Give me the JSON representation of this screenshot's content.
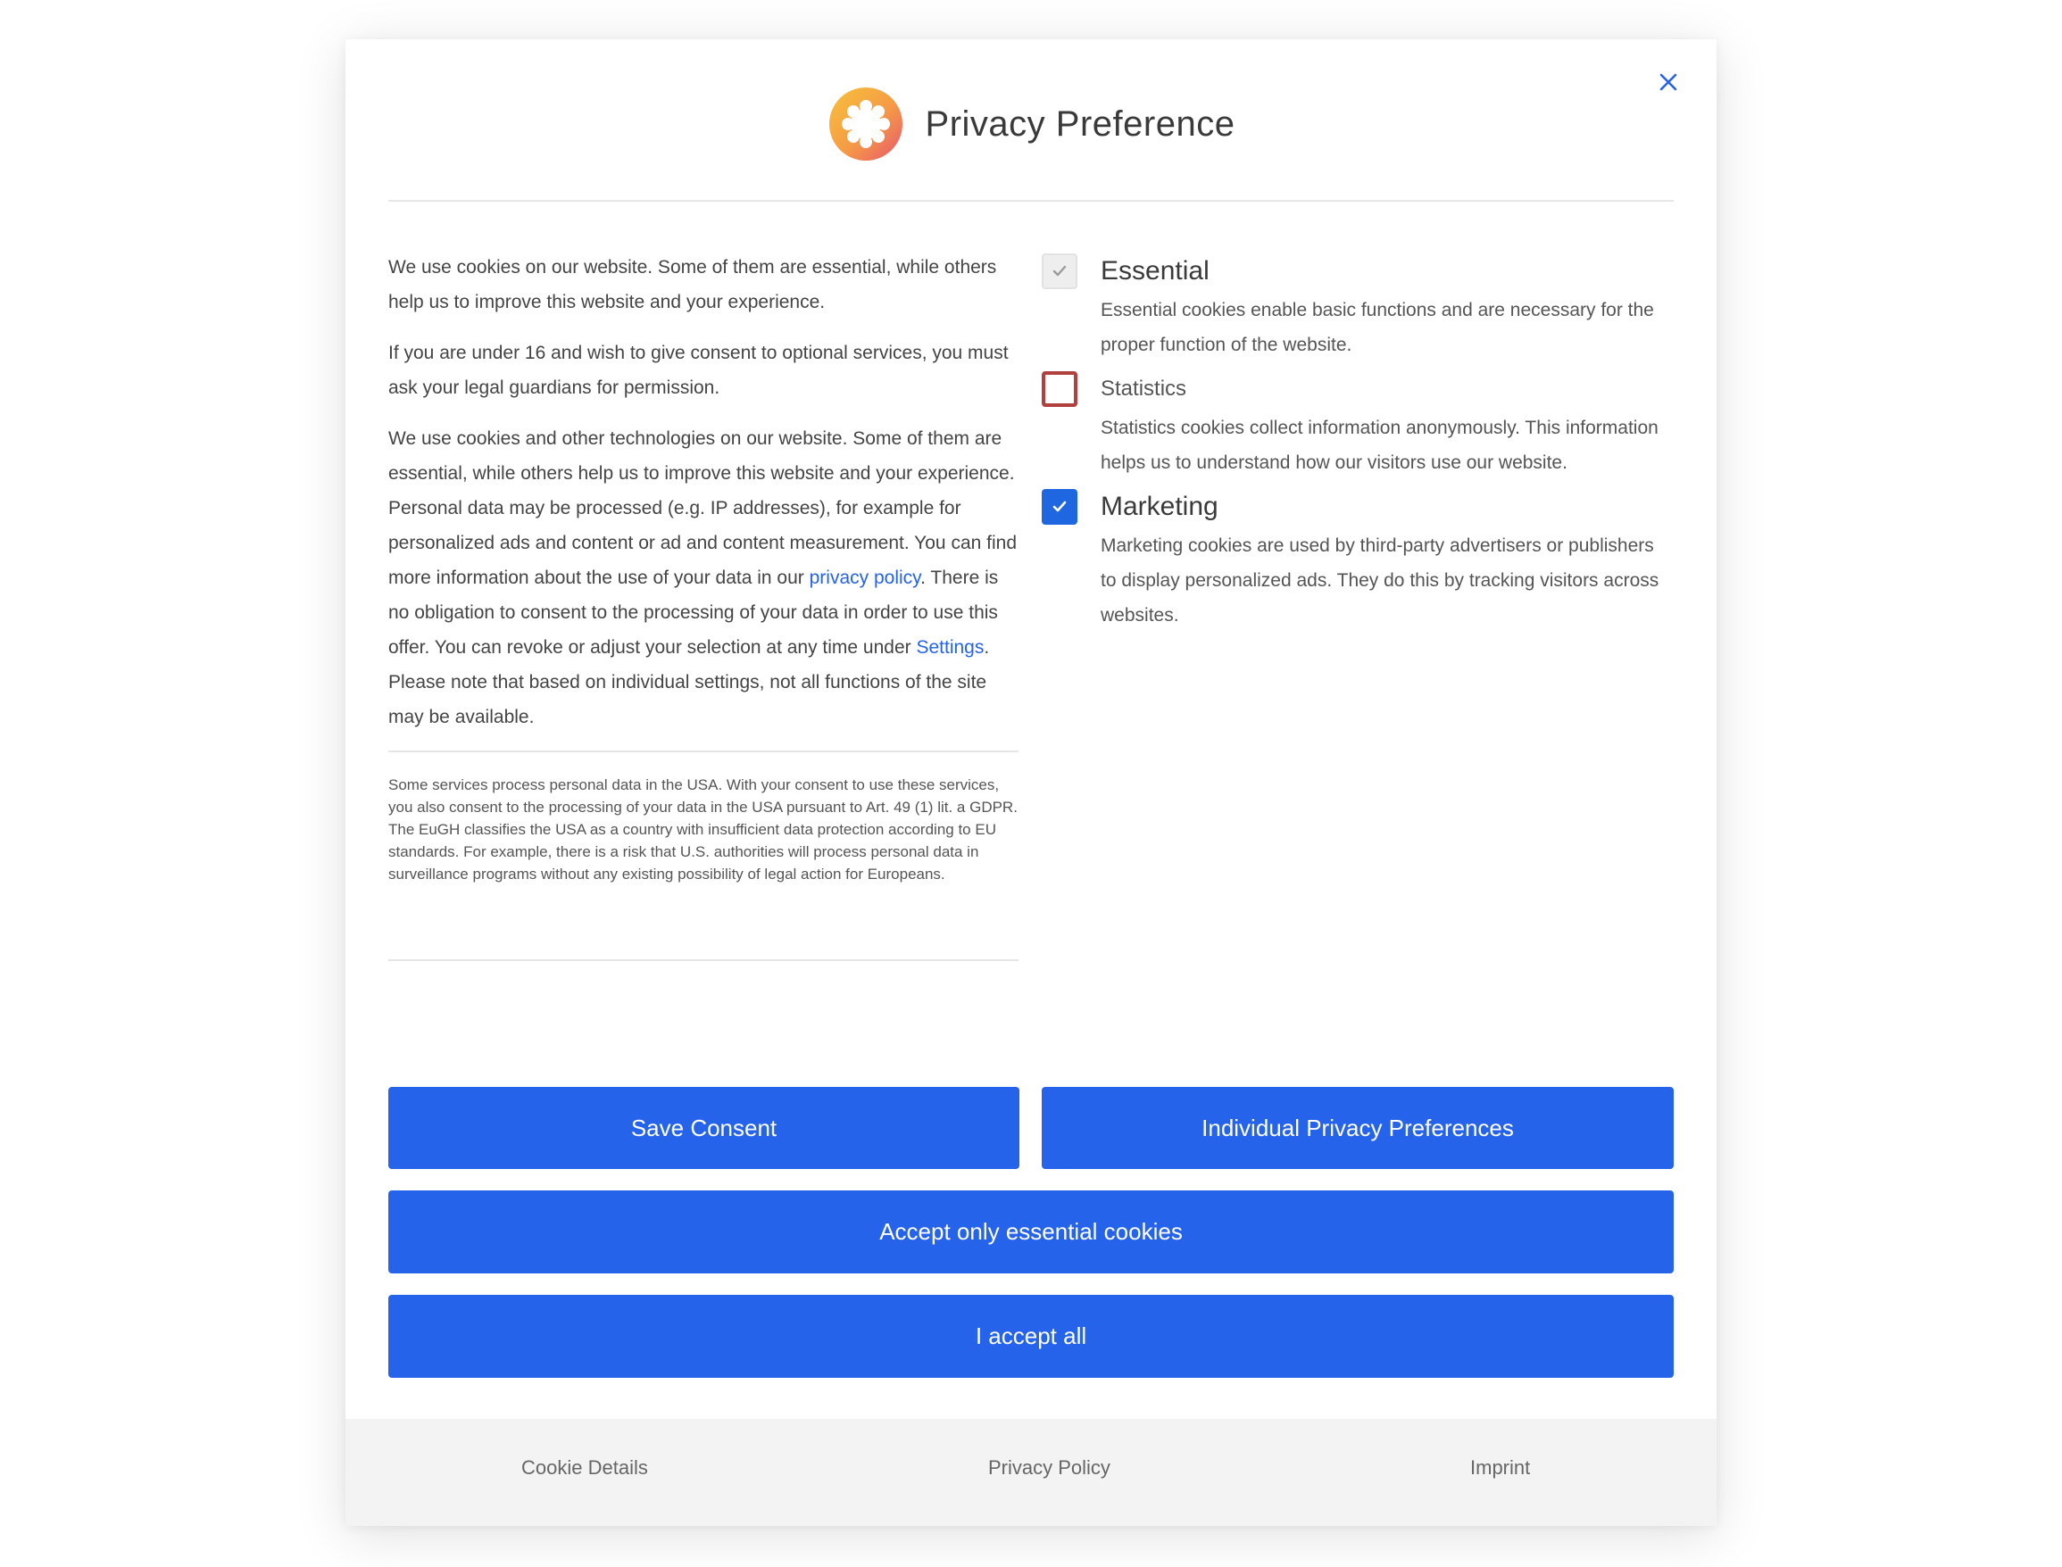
{
  "dialog": {
    "title": "Privacy Preference",
    "close_label": "×"
  },
  "intro": {
    "p1": "We use cookies on our website. Some of them are essential, while others help us to improve this website and your experience.",
    "p2": "If you are under 16 and wish to give consent to optional services, you must ask your legal guardians for permission.",
    "p3_pre": "We use cookies and other technologies on our website. Some of them are essential, while others help us to improve this website and your experience. Personal data may be processed (e.g. IP addresses), for example for personalized ads and content or ad and content measurement. You can find more information about the use of your data in our ",
    "privacy_link": "privacy policy",
    "p3_mid": ". There is no obligation to consent to the processing of your data in order to use this offer. You can revoke or adjust your selection at any time under ",
    "settings_link": "Settings",
    "p3_post": ". Please note that based on individual settings, not all functions of the site may be available.",
    "fine_print": "Some services process personal data in the USA. With your consent to use these services, you also consent to the processing of your data in the USA pursuant to Art. 49 (1) lit. a GDPR. The EuGH classifies the USA as a country with insufficient data protection according to EU standards. For example, there is a risk that U.S. authorities will process personal data in surveillance programs without any existing possibility of legal action for Europeans."
  },
  "options": [
    {
      "label": "Essential",
      "description": "Essential cookies enable basic functions and are necessary for the proper function of the website.",
      "checked": true,
      "locked": true
    },
    {
      "label": "Statistics",
      "description": "Statistics cookies collect information anonymously. This information helps us to understand how our visitors use our website.",
      "checked": false,
      "locked": false
    },
    {
      "label": "Marketing",
      "description": "Marketing cookies are used by third-party advertisers or publishers to display personalized ads. They do this by tracking visitors across websites.",
      "checked": true,
      "locked": false
    }
  ],
  "buttons": {
    "save": "Save Consent",
    "individual": "Individual Privacy Preferences",
    "essential_only": "Accept only essential cookies",
    "accept_all": "I accept all"
  },
  "footer": {
    "link1": "Cookie Details",
    "link2": "Privacy Policy",
    "link3": "Imprint"
  },
  "colors": {
    "primary": "#2563eb",
    "statistics_border": "#b0413e",
    "footer_bg": "#f3f3f3"
  }
}
